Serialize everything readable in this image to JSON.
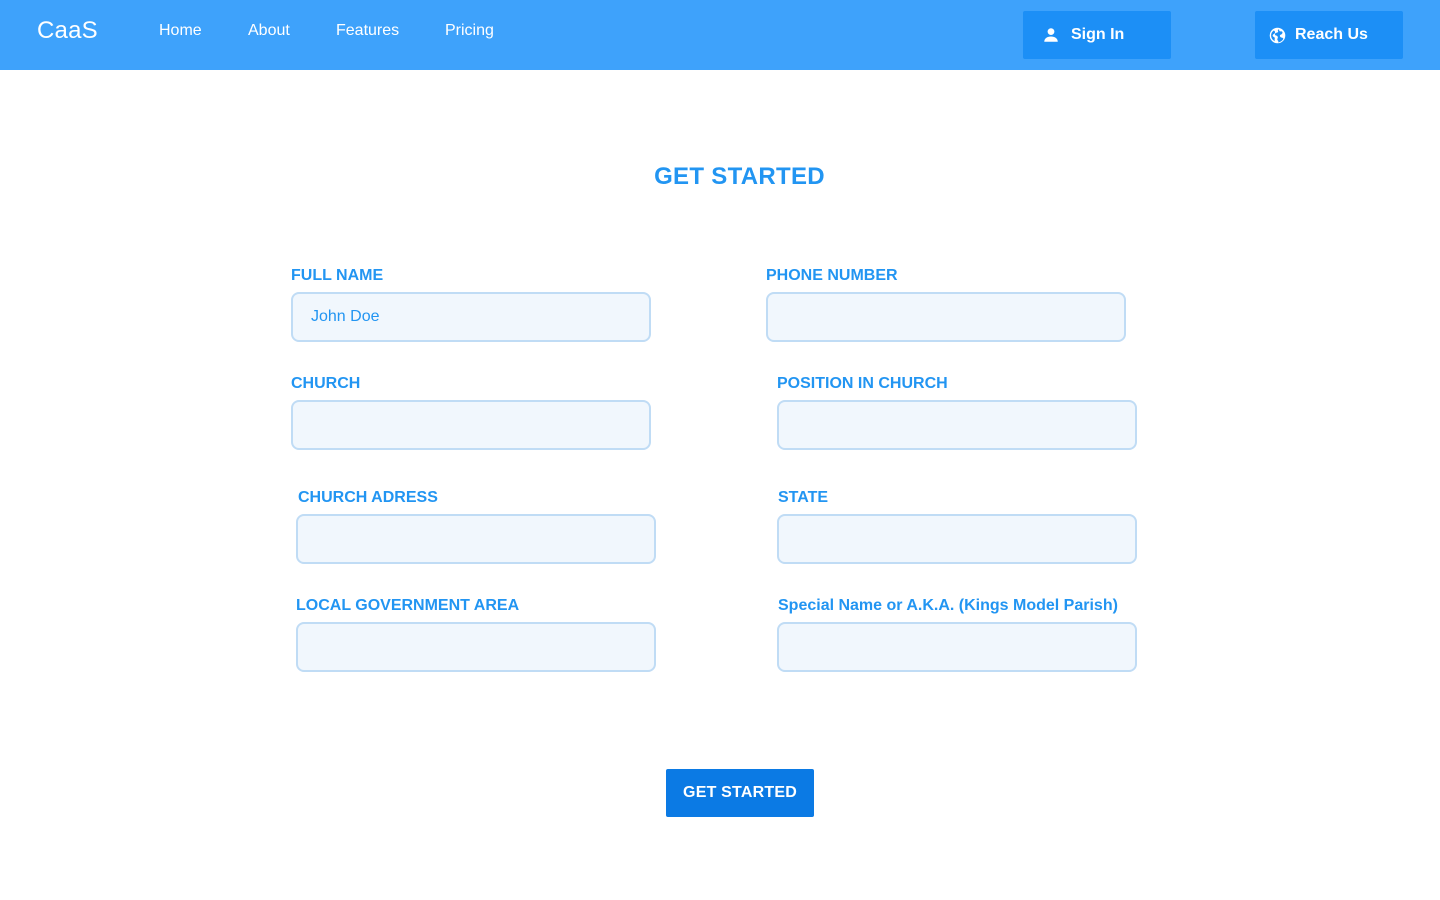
{
  "nav": {
    "brand": "CaaS",
    "links": [
      {
        "label": "Home"
      },
      {
        "label": "About"
      },
      {
        "label": "Features"
      },
      {
        "label": "Pricing"
      }
    ],
    "sign_in": {
      "label": "Sign In",
      "icon": "user-icon"
    },
    "reach_us": {
      "label": "Reach Us",
      "icon": "globe-icon"
    }
  },
  "form": {
    "title": "GET STARTED",
    "fields": {
      "full_name": {
        "label": "FULL NAME",
        "value": "John Doe"
      },
      "phone_number": {
        "label": "PHONE NUMBER",
        "value": ""
      },
      "church": {
        "label": "CHURCH",
        "value": ""
      },
      "position": {
        "label": "POSITION IN CHURCH",
        "value": ""
      },
      "church_address": {
        "label": "CHURCH ADRESS",
        "value": ""
      },
      "state": {
        "label": "STATE",
        "value": ""
      },
      "lga": {
        "label": "LOCAL GOVERNMENT AREA",
        "value": ""
      },
      "special_name": {
        "label": "Special Name or A.K.A. (Kings Model Parish)",
        "value": ""
      }
    },
    "submit_label": "GET STARTED"
  },
  "colors": {
    "navbar": "#3ea2fb",
    "nav_button": "#1c8ff6",
    "accent": "#2295f2",
    "submit": "#0b7ae4",
    "input_bg": "#f1f7fd",
    "input_border": "#c0dcf5"
  }
}
